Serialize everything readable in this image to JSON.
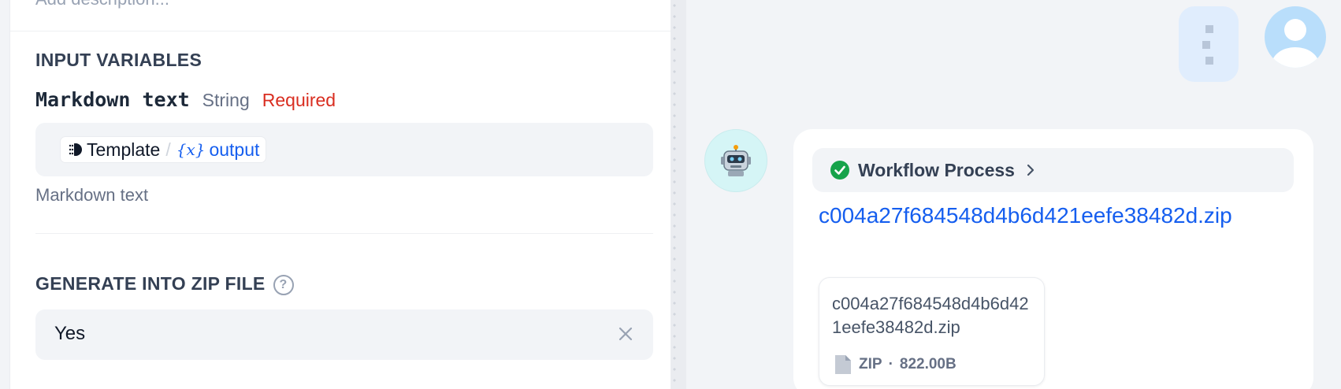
{
  "left": {
    "description_placeholder": "Add description...",
    "input_variables": {
      "title": "INPUT VARIABLES",
      "variable": {
        "name": "Markdown text",
        "type": "String",
        "required": "Required",
        "value_node": "Template",
        "value_separator": "/",
        "value_var_icon": "{x}",
        "value_var_name": "output",
        "description": "Markdown text"
      }
    },
    "generate_zip": {
      "title": "GENERATE INTO ZIP FILE",
      "help_icon": "?",
      "value": "Yes"
    }
  },
  "right": {
    "workflow": {
      "label": "Workflow Process",
      "status_color": "#16a34a"
    },
    "message": {
      "link_text": "c004a27f684548d4b6d421eefe38482d.zip"
    },
    "file": {
      "name": "c004a27f684548d4b6d421eefe38482d.zip",
      "type": "ZIP",
      "separator": "·",
      "size": "822.00B"
    }
  },
  "colors": {
    "accent": "#155eef",
    "required": "#d92d20",
    "success": "#16a34a"
  }
}
